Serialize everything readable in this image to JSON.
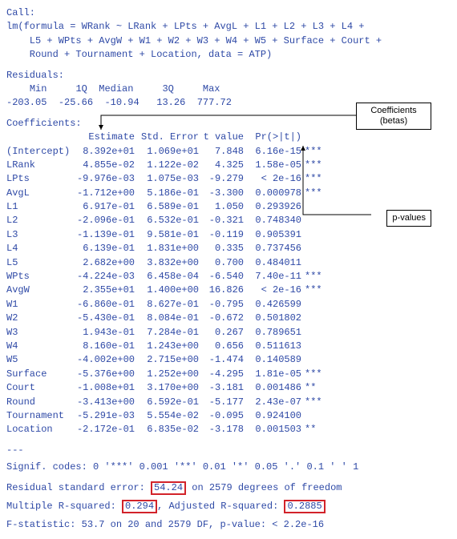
{
  "call": {
    "label": "Call:",
    "line1": "lm(formula = WRank ~ LRank + LPts + AvgL + L1 + L2 + L3 + L4 +",
    "line2": "    L5 + WPts + AvgW + W1 + W2 + W3 + W4 + W5 + Surface + Court +",
    "line3": "    Round + Tournament + Location, data = ATP)"
  },
  "residuals": {
    "title": "Residuals:",
    "headers": [
      "Min",
      "1Q",
      "Median",
      "3Q",
      "Max"
    ],
    "values": [
      "-203.05",
      "-25.66",
      "-10.94",
      "13.26",
      "777.72"
    ]
  },
  "coeff_title": "Coefficients:",
  "coeff_headers": {
    "est": "Estimate",
    "se": "Std. Error",
    "t": "t value",
    "p": "Pr(>|t|)"
  },
  "coefficients": [
    {
      "name": "(Intercept)",
      "est": "8.392e+01",
      "se": "1.069e+01",
      "t": "7.848",
      "p": "6.16e-15",
      "sig": "***"
    },
    {
      "name": "LRank",
      "est": "4.855e-02",
      "se": "1.122e-02",
      "t": "4.325",
      "p": "1.58e-05",
      "sig": "***"
    },
    {
      "name": "LPts",
      "est": "-9.976e-03",
      "se": "1.075e-03",
      "t": "-9.279",
      "p": "< 2e-16",
      "sig": "***"
    },
    {
      "name": "AvgL",
      "est": "-1.712e+00",
      "se": "5.186e-01",
      "t": "-3.300",
      "p": "0.000978",
      "sig": "***"
    },
    {
      "name": "L1",
      "est": "6.917e-01",
      "se": "6.589e-01",
      "t": "1.050",
      "p": "0.293926",
      "sig": ""
    },
    {
      "name": "L2",
      "est": "-2.096e-01",
      "se": "6.532e-01",
      "t": "-0.321",
      "p": "0.748340",
      "sig": ""
    },
    {
      "name": "L3",
      "est": "-1.139e-01",
      "se": "9.581e-01",
      "t": "-0.119",
      "p": "0.905391",
      "sig": ""
    },
    {
      "name": "L4",
      "est": "6.139e-01",
      "se": "1.831e+00",
      "t": "0.335",
      "p": "0.737456",
      "sig": ""
    },
    {
      "name": "L5",
      "est": "2.682e+00",
      "se": "3.832e+00",
      "t": "0.700",
      "p": "0.484011",
      "sig": ""
    },
    {
      "name": "WPts",
      "est": "-4.224e-03",
      "se": "6.458e-04",
      "t": "-6.540",
      "p": "7.40e-11",
      "sig": "***"
    },
    {
      "name": "AvgW",
      "est": "2.355e+01",
      "se": "1.400e+00",
      "t": "16.826",
      "p": "< 2e-16",
      "sig": "***"
    },
    {
      "name": "W1",
      "est": "-6.860e-01",
      "se": "8.627e-01",
      "t": "-0.795",
      "p": "0.426599",
      "sig": ""
    },
    {
      "name": "W2",
      "est": "-5.430e-01",
      "se": "8.084e-01",
      "t": "-0.672",
      "p": "0.501802",
      "sig": ""
    },
    {
      "name": "W3",
      "est": "1.943e-01",
      "se": "7.284e-01",
      "t": "0.267",
      "p": "0.789651",
      "sig": ""
    },
    {
      "name": "W4",
      "est": "8.160e-01",
      "se": "1.243e+00",
      "t": "0.656",
      "p": "0.511613",
      "sig": ""
    },
    {
      "name": "W5",
      "est": "-4.002e+00",
      "se": "2.715e+00",
      "t": "-1.474",
      "p": "0.140589",
      "sig": ""
    },
    {
      "name": "Surface",
      "est": "-5.376e+00",
      "se": "1.252e+00",
      "t": "-4.295",
      "p": "1.81e-05",
      "sig": "***"
    },
    {
      "name": "Court",
      "est": "-1.008e+01",
      "se": "3.170e+00",
      "t": "-3.181",
      "p": "0.001486",
      "sig": "**"
    },
    {
      "name": "Round",
      "est": "-3.413e+00",
      "se": "6.592e-01",
      "t": "-5.177",
      "p": "2.43e-07",
      "sig": "***"
    },
    {
      "name": "Tournament",
      "est": "-5.291e-03",
      "se": "5.554e-02",
      "t": "-0.095",
      "p": "0.924100",
      "sig": ""
    },
    {
      "name": "Location",
      "est": "-2.172e-01",
      "se": "6.835e-02",
      "t": "-3.178",
      "p": "0.001503",
      "sig": "**"
    }
  ],
  "dashes": "---",
  "signif": "Signif. codes:  0 '***' 0.001 '**' 0.01 '*' 0.05 '.' 0.1 ' ' 1",
  "footer": {
    "rse_pre": "Residual standard error: ",
    "rse_val": "54.24",
    "rse_post": " on 2579 degrees of freedom",
    "r2_pre": "Multiple R-squared: ",
    "r2_val": "0.294",
    "r2_mid": ",     Adjusted R-squared: ",
    "ar2_val": "0.2885",
    "fstat": "F-statistic:  53.7 on 20 and 2579 DF,  p-value: < 2.2e-16"
  },
  "annotations": {
    "coef_label": "Coefficients (betas)",
    "pval_label": "p-values"
  }
}
